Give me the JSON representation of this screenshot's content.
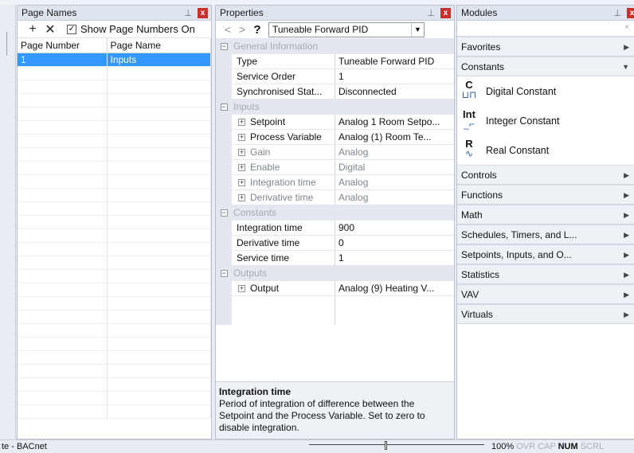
{
  "page_names": {
    "title": "Page Names",
    "add_label": "+",
    "remove_label": "✕",
    "show_numbers_label": "Show Page Numbers On",
    "show_numbers_checked": "✓",
    "columns": [
      "Page Number",
      "Page Name"
    ],
    "rows": [
      {
        "number": "1",
        "name": "Inputs"
      }
    ]
  },
  "properties": {
    "title": "Properties",
    "back_label": "<",
    "forward_label": ">",
    "help_label": "?",
    "selected_block": "Tuneable Forward PID",
    "sections": {
      "general": {
        "label": "General Information",
        "rows": [
          {
            "name": "Type",
            "value": "Tuneable Forward PID"
          },
          {
            "name": "Service Order",
            "value": "1"
          },
          {
            "name": "Synchronised Stat...",
            "value": "Disconnected"
          }
        ]
      },
      "inputs": {
        "label": "Inputs",
        "rows": [
          {
            "name": "Setpoint",
            "value": "Analog 1 Room Setpo..."
          },
          {
            "name": "Process Variable",
            "value": "Analog (1) Room Te..."
          },
          {
            "name": "Gain",
            "value": "Analog"
          },
          {
            "name": "Enable",
            "value": "Digital"
          },
          {
            "name": "Integration time",
            "value": "Analog"
          },
          {
            "name": "Derivative time",
            "value": "Analog"
          }
        ]
      },
      "constants": {
        "label": "Constants",
        "rows": [
          {
            "name": "Integration time",
            "value": "900"
          },
          {
            "name": "Derivative time",
            "value": "0"
          },
          {
            "name": "Service time",
            "value": "1"
          }
        ]
      },
      "outputs": {
        "label": "Outputs",
        "rows": [
          {
            "name": "Output",
            "value": "Analog (9) Heating V..."
          }
        ]
      }
    },
    "description": {
      "title": "Integration time",
      "text": "Period of integration of difference between the Setpoint and the Process Variable. Set to zero to disable integration."
    }
  },
  "modules": {
    "title": "Modules",
    "search_clear": "×",
    "groups": [
      "Favorites",
      "Constants",
      "Controls",
      "Functions",
      "Math",
      "Schedules, Timers, and L...",
      "Setpoints, Inputs, and O...",
      "Statistics",
      "VAV",
      "Virtuals"
    ],
    "constants_items": [
      {
        "label": "Digital Constant",
        "glyph": "C",
        "sub": "⊔⊓",
        "icon": "digital-constant-icon"
      },
      {
        "label": "Integer Constant",
        "glyph": "Int",
        "sub": "_⌐",
        "icon": "integer-constant-icon"
      },
      {
        "label": "Real Constant",
        "glyph": "R",
        "sub": "∿",
        "icon": "real-constant-icon"
      }
    ]
  },
  "status": {
    "left_text": "te - BACnet",
    "zoom": "100%",
    "ovr": "OVR",
    "cap": "CAP",
    "num": "NUM",
    "scrl": "SCRL"
  }
}
